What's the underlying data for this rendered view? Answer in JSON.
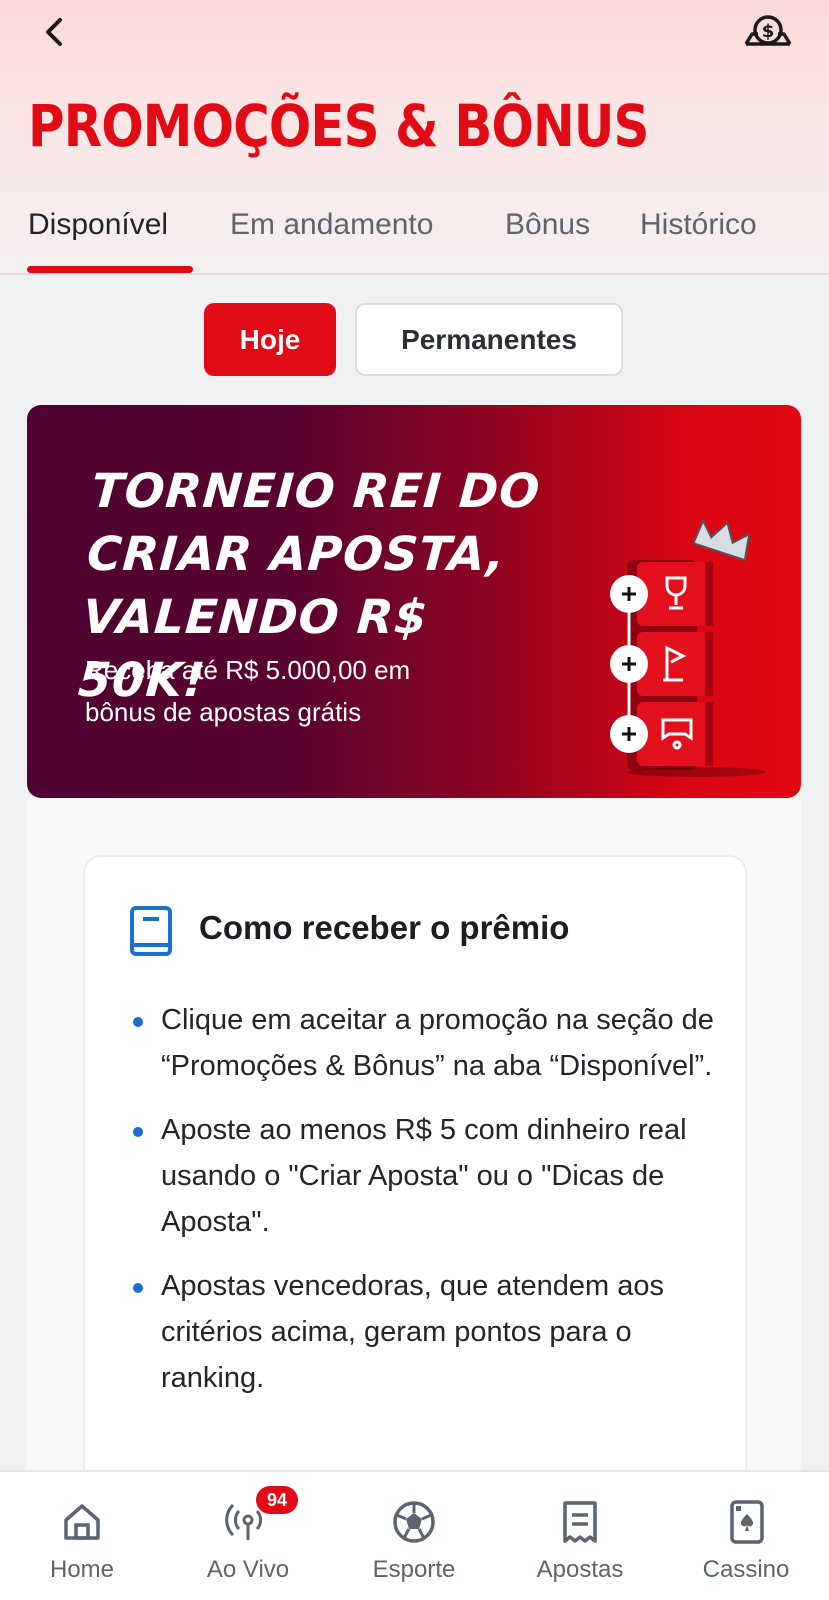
{
  "header": {
    "title": "PROMOÇÕES & BÔNUS"
  },
  "tabs": [
    {
      "label": "Disponível",
      "active": true
    },
    {
      "label": "Em andamento",
      "active": false
    },
    {
      "label": "Bônus",
      "active": false
    },
    {
      "label": "Histórico",
      "active": false
    }
  ],
  "filters": [
    {
      "label": "Hoje",
      "selected": true
    },
    {
      "label": "Permanentes",
      "selected": false
    }
  ],
  "banner": {
    "title_lines": [
      "TORNEIO REI DO",
      "CRIAR APOSTA,",
      "VALENDO R$ 50K!"
    ],
    "subtitle_lines": [
      "Receba até R$ 5.000,00 em",
      "bônus de apostas grátis"
    ]
  },
  "card": {
    "title": "Como receber o prêmio",
    "bullets": [
      "Clique em aceitar a promoção na seção de “Promoções & Bônus” na aba “Disponível”.",
      "Aposte ao menos R$ 5 com dinheiro real usando o \"Criar Aposta\" ou o \"Dicas de Aposta\".",
      "Apostas vencedoras, que atendem aos critérios acima, geram pontos para o ranking."
    ]
  },
  "bottom_nav": [
    {
      "label": "Home",
      "icon": "home-icon"
    },
    {
      "label": "Ao Vivo",
      "icon": "live-icon",
      "badge": "94"
    },
    {
      "label": "Esporte",
      "icon": "soccer-ball-icon"
    },
    {
      "label": "Apostas",
      "icon": "receipt-icon"
    },
    {
      "label": "Cassino",
      "icon": "cards-icon"
    }
  ],
  "colors": {
    "brand_red": "#e00b14",
    "banner_dark": "#4d0330",
    "bullet_blue": "#1a6fd1"
  }
}
